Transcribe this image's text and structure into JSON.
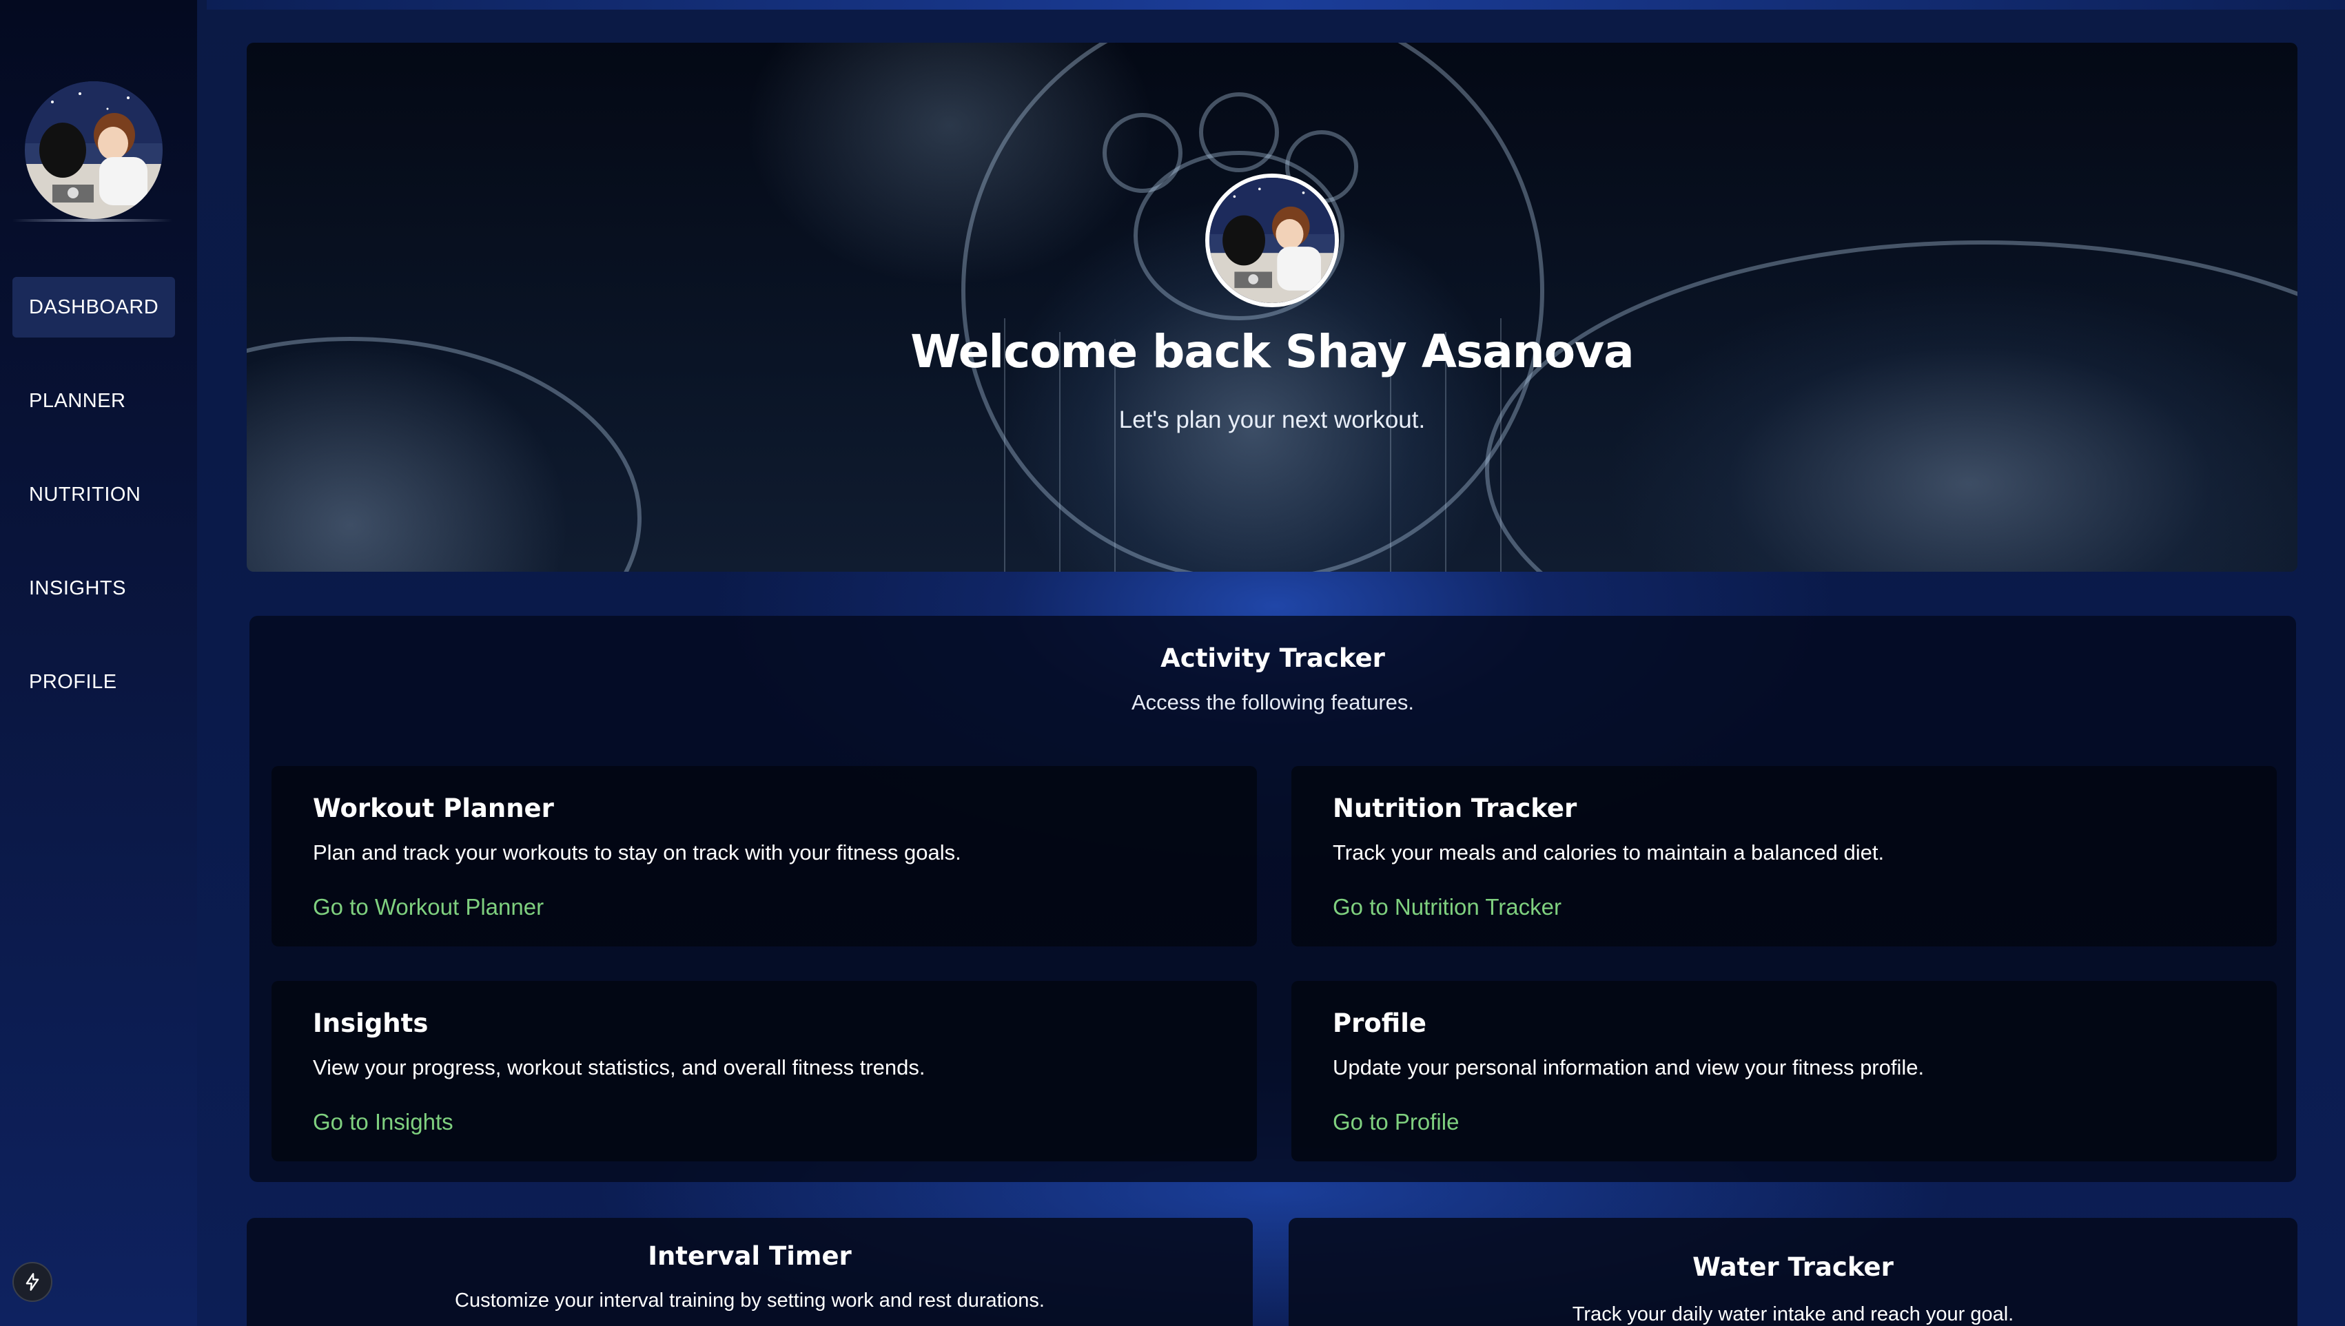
{
  "sidebar": {
    "avatar_alt": "User avatar",
    "items": [
      {
        "label": "DASHBOARD",
        "active": true
      },
      {
        "label": "PLANNER"
      },
      {
        "label": "NUTRITION"
      },
      {
        "label": "INSIGHTS"
      },
      {
        "label": "PROFILE"
      }
    ],
    "footer_icon": "lightning-bolt-icon"
  },
  "hero": {
    "title": "Welcome back Shay Asanova",
    "subtitle": "Let's plan your next workout."
  },
  "tracker": {
    "title": "Activity Tracker",
    "subtitle": "Access the following features.",
    "cards": [
      {
        "title": "Workout Planner",
        "description": "Plan and track your workouts to stay on track with your fitness goals.",
        "link": "Go to Workout Planner"
      },
      {
        "title": "Nutrition Tracker",
        "description": "Track your meals and calories to maintain a balanced diet.",
        "link": "Go to Nutrition Tracker"
      },
      {
        "title": "Insights",
        "description": "View your progress, workout statistics, and overall fitness trends.",
        "link": "Go to Insights"
      },
      {
        "title": "Profile",
        "description": "Update your personal information and view your fitness profile.",
        "link": "Go to Profile"
      }
    ]
  },
  "bottom": {
    "interval": {
      "title": "Interval Timer",
      "subtitle": "Customize your interval training by setting work and rest durations."
    },
    "water": {
      "title": "Water Tracker",
      "subtitle": "Track your daily water intake and reach your goal."
    }
  },
  "colors": {
    "link": "#7fd07f",
    "active_nav": "#1a2a5a",
    "background": "#0a1a4a"
  }
}
